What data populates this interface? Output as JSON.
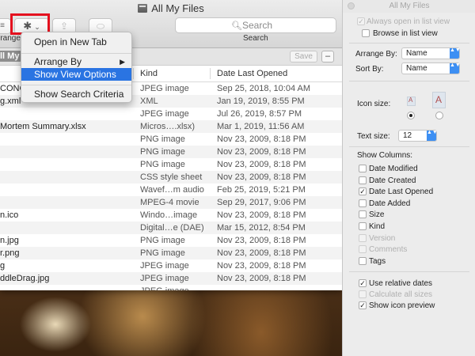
{
  "window": {
    "title": "All My Files",
    "view_button_glyph": "≡",
    "gear_glyph": "✱",
    "chevron_glyph": "⌄",
    "share_glyph": "⇪",
    "tag_glyph": "⬭",
    "search_placeholder": "Search",
    "search_caption": "Search",
    "arrange_caption": "rrange",
    "scope_chip": "ll My",
    "save_label": "Save",
    "minus_label": "–"
  },
  "columns": {
    "kind": "Kind",
    "date": "Date Last Opened"
  },
  "rows": [
    {
      "name": "CONG",
      "kind": "JPEG image",
      "date": "Sep 25, 2018, 10:04 AM"
    },
    {
      "name": "g.xml",
      "kind": "XML",
      "date": "Jan 19, 2019, 8:55 PM"
    },
    {
      "name": "",
      "kind": "JPEG image",
      "date": "Jul 26, 2019, 8:57 PM"
    },
    {
      "name": "Mortem Summary.xlsx",
      "kind": "Micros….xlsx)",
      "date": "Mar 1, 2019, 11:56 AM"
    },
    {
      "name": "",
      "kind": "PNG image",
      "date": "Nov 23, 2009, 8:18 PM"
    },
    {
      "name": "",
      "kind": "PNG image",
      "date": "Nov 23, 2009, 8:18 PM"
    },
    {
      "name": "",
      "kind": "PNG image",
      "date": "Nov 23, 2009, 8:18 PM"
    },
    {
      "name": "",
      "kind": "CSS style sheet",
      "date": "Nov 23, 2009, 8:18 PM"
    },
    {
      "name": "",
      "kind": "Wavef…m audio",
      "date": "Feb 25, 2019, 5:21 PM"
    },
    {
      "name": "",
      "kind": "MPEG-4 movie",
      "date": "Sep 29, 2017, 9:06 PM"
    },
    {
      "name": "n.ico",
      "kind": "Windo…image",
      "date": "Nov 23, 2009, 8:18 PM"
    },
    {
      "name": "",
      "kind": "Digital…e (DAE)",
      "date": "Mar 15, 2012, 8:54 PM"
    },
    {
      "name": "n.jpg",
      "kind": "PNG image",
      "date": "Nov 23, 2009, 8:18 PM"
    },
    {
      "name": "r.png",
      "kind": "PNG image",
      "date": "Nov 23, 2009, 8:18 PM"
    },
    {
      "name": "g",
      "kind": "JPEG image",
      "date": "Nov 23, 2009, 8:18 PM"
    },
    {
      "name": "ddleDrag.jpg",
      "kind": "JPEG image",
      "date": "Nov 23, 2009, 8:18 PM"
    },
    {
      "name": "",
      "kind": "JPEG image",
      "date": ""
    }
  ],
  "menu": {
    "open_new_tab": "Open in New Tab",
    "arrange_by": "Arrange By",
    "submenu_arrow": "▶",
    "show_view_options": "Show View Options",
    "show_search_criteria": "Show Search Criteria"
  },
  "panel": {
    "title": "All My Files",
    "always_open_list": "Always open in list view",
    "browse_list": "Browse in list view",
    "arrange_by_label": "Arrange By:",
    "arrange_by_value": "Name",
    "sort_by_label": "Sort By:",
    "sort_by_value": "Name",
    "icon_size_label": "Icon size:",
    "text_size_label": "Text size:",
    "text_size_value": "12",
    "show_columns_label": "Show Columns:",
    "select_arrows": "▲▼",
    "columns": [
      {
        "label": "Date Modified",
        "checked": false,
        "disabled": false
      },
      {
        "label": "Date Created",
        "checked": false,
        "disabled": false
      },
      {
        "label": "Date Last Opened",
        "checked": true,
        "disabled": false
      },
      {
        "label": "Date Added",
        "checked": false,
        "disabled": false
      },
      {
        "label": "Size",
        "checked": false,
        "disabled": false
      },
      {
        "label": "Kind",
        "checked": false,
        "disabled": false
      },
      {
        "label": "Version",
        "checked": false,
        "disabled": true
      },
      {
        "label": "Comments",
        "checked": false,
        "disabled": true
      },
      {
        "label": "Tags",
        "checked": false,
        "disabled": false
      }
    ],
    "options": [
      {
        "label": "Use relative dates",
        "checked": true,
        "disabled": false
      },
      {
        "label": "Calculate all sizes",
        "checked": false,
        "disabled": true
      },
      {
        "label": "Show icon preview",
        "checked": true,
        "disabled": false
      }
    ]
  },
  "colors": {
    "highlight_red": "#e4101e",
    "menu_selection": "#2a74e2",
    "select_arrow_blue": "#3d8ff3"
  }
}
